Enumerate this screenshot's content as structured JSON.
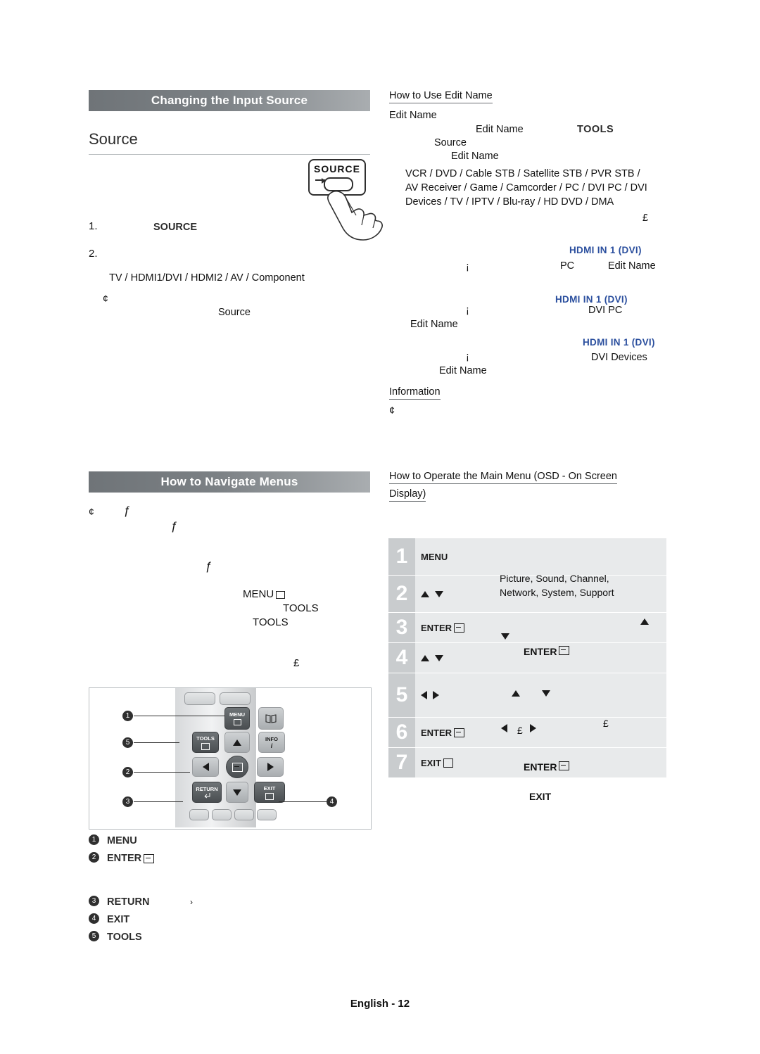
{
  "sections": {
    "input_source": {
      "bar_title": "Changing the Input Source",
      "h2": "Source",
      "step1_num": "1.",
      "step1_text": "SOURCE",
      "step2_num": "2.",
      "list_text": "TV / HDMI1/DVI / HDMI2 / AV / Component",
      "note_mark": "¢",
      "note_text": "Source",
      "source_key_label": "SOURCE"
    },
    "navigate": {
      "bar_title": "How to Navigate Menus",
      "bullet_mark": "¢",
      "f1": "ƒ",
      "f2": "ƒ",
      "f3": "ƒ",
      "menu_label": "MENU",
      "tools_label_1": "TOOLS",
      "tools_label_2": "TOOLS",
      "pound": "£"
    },
    "edit_name": {
      "heading": "How to Use Edit Name",
      "line1": "Edit Name",
      "line2_a": "Edit Name",
      "line2_b": "TOOLS",
      "line3": "Source",
      "line4": "Edit Name",
      "devices_1": "VCR / DVD / Cable STB / Satellite STB / PVR STB /",
      "devices_2": "AV Receiver / Game / Camcorder / PC / DVI PC / DVI",
      "devices_3": "Devices / TV / IPTV / Blu-ray / HD DVD / DMA",
      "pound": "£",
      "item1_mark": "¡",
      "item1_blue": "HDMI IN 1 (DVI)",
      "item1_a": "PC",
      "item1_b": "Edit Name",
      "item2_mark": "¡",
      "item2_blue": "HDMI IN 1 (DVI)",
      "item2_a": "DVI PC",
      "item2_b": "Edit Name",
      "item3_mark": "¡",
      "item3_blue": "HDMI IN 1 (DVI)",
      "item3_a": "DVI Devices",
      "item3_b": "Edit Name",
      "information": "Information",
      "info_mark": "¢"
    },
    "osd": {
      "heading_line1": "How to Operate the Main Menu (OSD - On Screen",
      "heading_line2": "Display)",
      "rows": [
        {
          "n": "1",
          "key": "MENU",
          "key_icon": "none"
        },
        {
          "n": "2",
          "key": "",
          "key_icon": "updown"
        },
        {
          "n": "3",
          "key": "ENTER",
          "key_icon": "enter"
        },
        {
          "n": "4",
          "key": "",
          "key_icon": "updown"
        },
        {
          "n": "5",
          "key": "",
          "key_icon": "leftright"
        },
        {
          "n": "6",
          "key": "ENTER",
          "key_icon": "enter"
        },
        {
          "n": "7",
          "key": "EXIT",
          "key_icon": "exit"
        }
      ],
      "desc_1a": "Picture, Sound, Channel,",
      "desc_1b": "Network, System, Support",
      "desc_3": "ENTER",
      "desc_6": "ENTER",
      "desc_7": "EXIT",
      "pound_a": "£",
      "pound_b": "£"
    },
    "remote": {
      "keys": {
        "menu": "MENU",
        "tools": "TOOLS",
        "info": "INFO",
        "return": "RETURN",
        "exit": "EXIT"
      },
      "callouts": [
        {
          "n": "1",
          "label": "MENU"
        },
        {
          "n": "2",
          "label": "ENTER"
        },
        {
          "n": "3",
          "label": "RETURN"
        },
        {
          "n": "4",
          "label": "EXIT"
        },
        {
          "n": "5",
          "label": "TOOLS"
        }
      ],
      "legend": [
        {
          "n": "1",
          "label": "MENU"
        },
        {
          "n": "2",
          "label": "ENTER"
        },
        {
          "n": "3",
          "label": "RETURN"
        },
        {
          "n": "4",
          "label": "EXIT"
        },
        {
          "n": "5",
          "label": "TOOLS"
        }
      ],
      "return_extra": "›"
    },
    "footer": "English - 12"
  }
}
